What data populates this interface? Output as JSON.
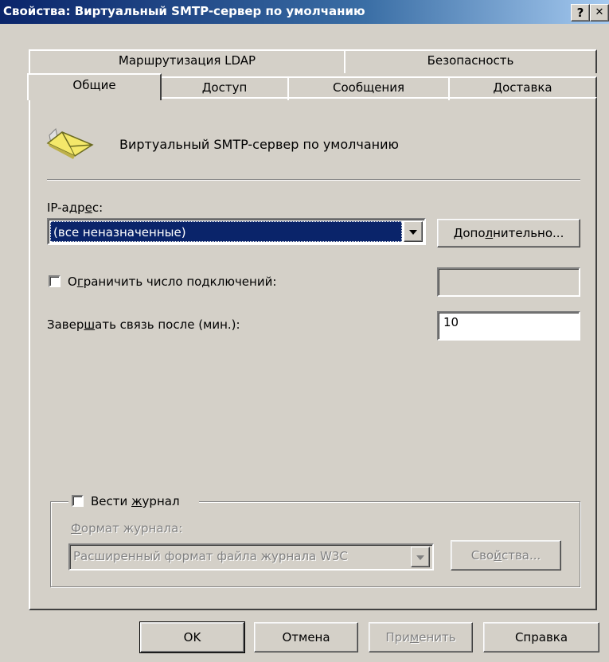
{
  "window": {
    "title": "Свойства: Виртуальный SMTP-сервер по умолчанию",
    "help_btn": "?",
    "close_btn": "✕"
  },
  "tabs_back": [
    "Маршрутизация LDAP",
    "Безопасность"
  ],
  "tabs_front": [
    "Общие",
    "Доступ",
    "Сообщения",
    "Доставка"
  ],
  "active_tab": "Общие",
  "header": {
    "icon": "envelope-icon",
    "server_name": "Виртуальный SMTP-сервер по умолчанию"
  },
  "ip": {
    "label_a": "IP-адр",
    "label_u": "е",
    "label_b": "с:",
    "selected": "(все неназначенные)",
    "advanced_a": "Допо",
    "advanced_u": "л",
    "advanced_b": "нительно..."
  },
  "limit": {
    "checked": false,
    "label_a": "О",
    "label_u": "г",
    "label_b": "раничить число подключений:",
    "value": ""
  },
  "timeout": {
    "label_a": "Завер",
    "label_u": "ш",
    "label_b": "ать связь после (мин.):",
    "value": "10"
  },
  "logging": {
    "checked": false,
    "label_a": "Вести ",
    "label_u": "ж",
    "label_b": "урнал",
    "format_a": "",
    "format_u": "Ф",
    "format_b": "ормат журнала:",
    "format_value": "Расширенный формат файла журнала W3C",
    "props_a": "Сво",
    "props_u": "й",
    "props_b": "ства..."
  },
  "buttons": {
    "ok": "OK",
    "cancel": "Отмена",
    "apply_a": "При",
    "apply_u": "м",
    "apply_b": "енить",
    "help": "Справка"
  },
  "colors": {
    "face": "#d4d0c8",
    "title_start": "#0a246a",
    "title_end": "#a6caf0",
    "selection": "#0a246a",
    "disabled_text": "#808080"
  }
}
